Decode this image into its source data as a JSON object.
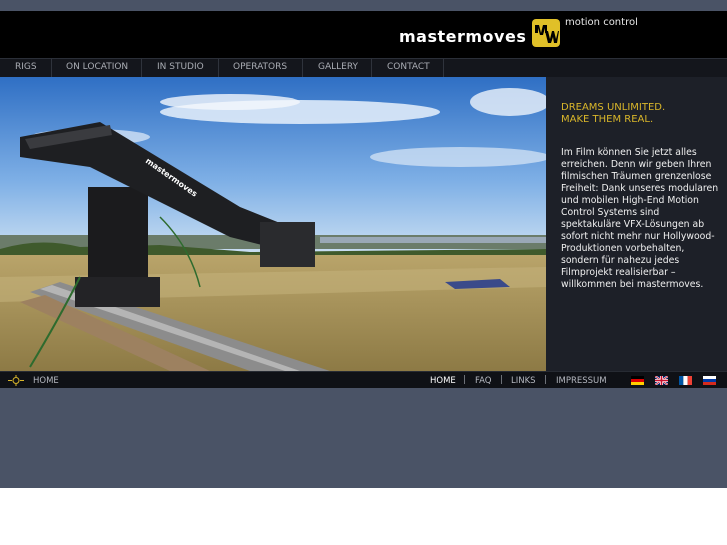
{
  "brand": {
    "name": "mastermoves",
    "tagline": "motion control",
    "accent_color": "#d9b62a"
  },
  "nav": {
    "items": [
      {
        "label": "RIGS"
      },
      {
        "label": "ON LOCATION"
      },
      {
        "label": "IN STUDIO"
      },
      {
        "label": "OPERATORS"
      },
      {
        "label": "GALLERY"
      },
      {
        "label": "CONTACT"
      }
    ]
  },
  "hero": {
    "image_label": "mastermoves"
  },
  "side": {
    "headline_line1": "DREAMS UNLIMITED.",
    "headline_line2": "MAKE THEM REAL.",
    "body": "Im Film können Sie jetzt alles erreichen. Denn wir geben Ihren filmischen Träumen grenzenlose Freiheit: Dank unseres modularen und mobilen High-End Motion Control Systems sind spektakuläre VFX-Lösungen ab sofort nicht mehr nur Hollywood-Produktionen vorbehalten, sondern für nahezu jedes Filmprojekt realisierbar – willkommen bei mastermoves."
  },
  "footer": {
    "home_label": "HOME",
    "links": [
      {
        "label": "HOME"
      },
      {
        "label": "FAQ"
      },
      {
        "label": "LINKS"
      },
      {
        "label": "IMPRESSUM"
      }
    ],
    "separator": "|",
    "flags": [
      "flag-de-icon",
      "flag-uk-icon",
      "flag-fr-icon",
      "flag-ru-icon"
    ]
  }
}
